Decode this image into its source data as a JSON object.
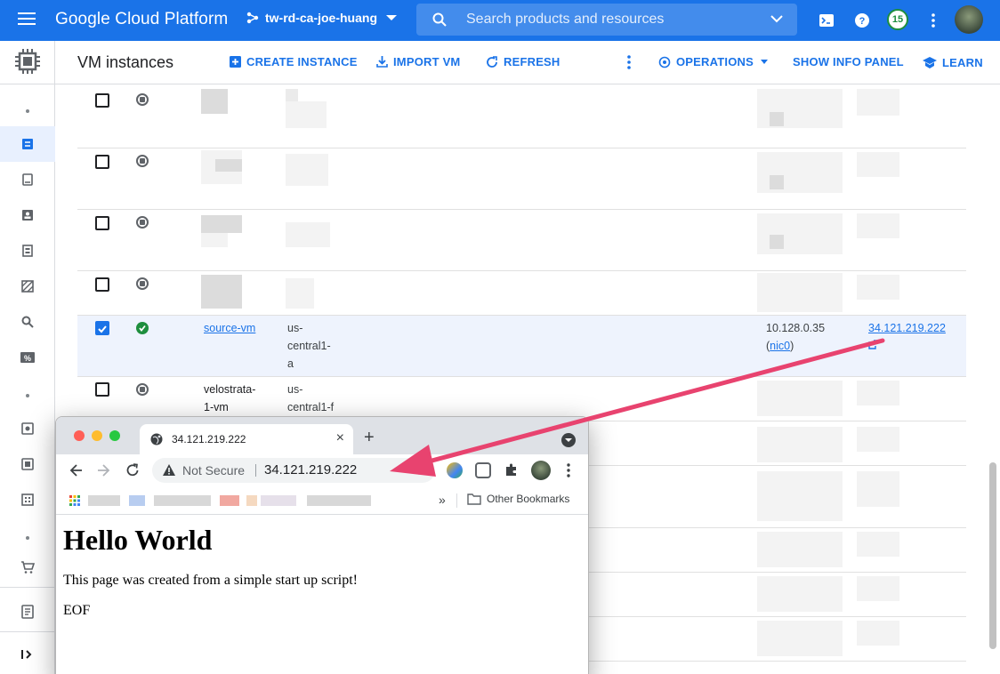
{
  "topbar": {
    "brand": "Google Cloud Platform",
    "project": "tw-rd-ca-joe-huang",
    "search_placeholder": "Search products and resources",
    "notification_count": "15"
  },
  "header": {
    "title": "VM instances",
    "create_instance": "CREATE INSTANCE",
    "import_vm": "IMPORT VM",
    "refresh": "REFRESH",
    "operations": "OPERATIONS",
    "show_info_panel": "SHOW INFO PANEL",
    "learn": "LEARN"
  },
  "table": {
    "selected_row": {
      "name": "source-vm",
      "zone_lines": [
        "us-",
        "central1-",
        "a"
      ],
      "internal_ip": "10.128.0.35",
      "internal_ip_nic": "nic0",
      "external_ip": "34.121.219.222",
      "status": "running"
    },
    "next_row": {
      "name_lines": [
        "velostrata-",
        "1-vm"
      ],
      "zone_lines": [
        "us-",
        "central1-f"
      ],
      "status": "stopped"
    }
  },
  "browser": {
    "tab_title": "34.121.219.222",
    "security_label": "Not Secure",
    "url": "34.121.219.222",
    "other_bookmarks": "Other Bookmarks",
    "overflow": "»",
    "page": {
      "heading": "Hello World",
      "paragraph": "This page was created from a simple start up script!",
      "footer": "EOF"
    }
  },
  "colors": {
    "brand_blue": "#1a73e8",
    "running_green": "#1e8e3e",
    "annotation_arrow": "#e8436f"
  }
}
